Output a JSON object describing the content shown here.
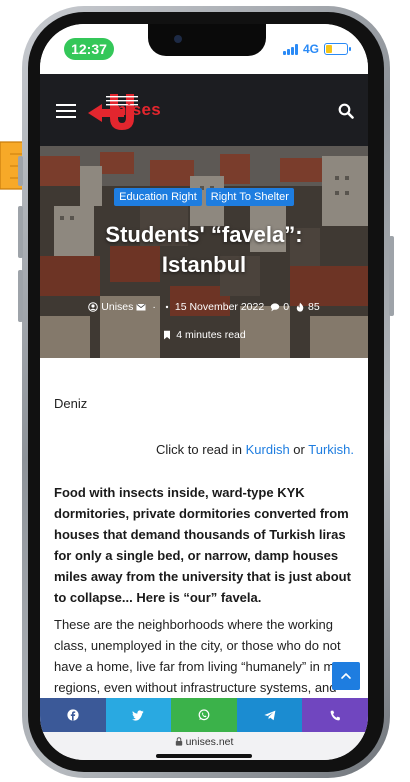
{
  "status": {
    "time": "12:37",
    "network": "4G"
  },
  "site": {
    "logo_text": "nises"
  },
  "hero": {
    "tags": [
      "Education Right",
      "Right To Shelter"
    ],
    "title_line1": "Students' “favela”:",
    "title_line2": "Istanbul",
    "author": "Unises",
    "date": "15 November 2022",
    "comments": "0",
    "views": "85",
    "read_time": "4 minutes read"
  },
  "article": {
    "author": "Deniz",
    "read_in_prefix": "Click to read in ",
    "link_kurdish": "Kurdish",
    "read_in_or": " or ",
    "link_turkish": "Turkish.",
    "lead": "Food with insects inside, ward-type KYK dormitories, private dormitories converted from houses that demand thousands of Turkish liras for only a single bed, or narrow, damp houses miles away from the university that is just about to collapse... Here is “our” favela.",
    "body": "These are the neighborhoods where the working class, unemployed in the city, or those who do not have a home, live far from living “humanely” in most regions, even without infrastructure systems, and where the"
  },
  "share": {
    "items": [
      "facebook-icon",
      "twitter-icon",
      "whatsapp-icon",
      "telegram-icon",
      "phone-icon"
    ]
  },
  "browser": {
    "url": "unises.net"
  },
  "colors": {
    "accent": "#1e7de0",
    "brand_red": "#e3262e",
    "header_bg": "#1c1d21",
    "status_pill": "#34c759"
  }
}
